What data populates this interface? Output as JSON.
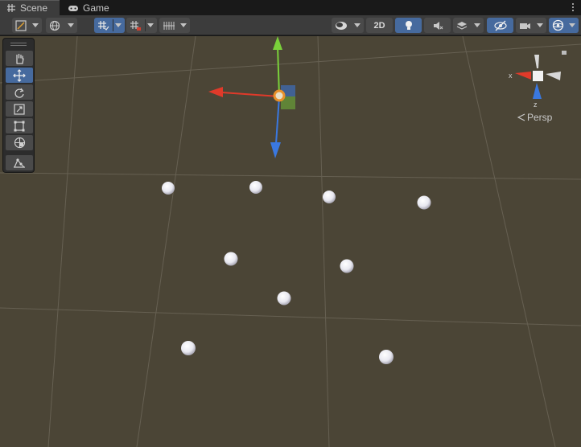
{
  "tabs": [
    {
      "label": "Scene",
      "icon": "grid-hash-icon",
      "active": true
    },
    {
      "label": "Game",
      "icon": "gamepad-icon",
      "active": false
    }
  ],
  "toolbar": {
    "buttons": [
      {
        "name": "draw-mode-dropdown",
        "icon": "shading-mode-icon"
      },
      {
        "name": "global-local-dropdown",
        "icon": "globe-icon"
      },
      {
        "name": "grid-snapping-dropdown",
        "icon": "grid-snap-icon",
        "active": true
      },
      {
        "name": "increment-snap-dropdown",
        "icon": "increment-snap-icon"
      },
      {
        "name": "grid-visibility-dropdown",
        "icon": "grid-lines-icon"
      },
      {
        "name": "render-mode-dropdown",
        "icon": "sphere-shading-icon"
      },
      {
        "name": "lighting-toggle",
        "icon": "lightbulb-icon",
        "active": true
      },
      {
        "name": "audio-toggle",
        "icon": "speaker-icon"
      },
      {
        "name": "effects-dropdown",
        "icon": "effects-layers-icon"
      },
      {
        "name": "hidden-objects-toggle",
        "icon": "eye-slash-icon",
        "active": true
      },
      {
        "name": "camera-dropdown",
        "icon": "camera-icon"
      },
      {
        "name": "gizmos-dropdown",
        "icon": "gizmo-sphere-icon",
        "active": true
      }
    ],
    "mode_2d_label": "2D"
  },
  "tools": [
    {
      "name": "hand-tool",
      "icon": "hand-icon",
      "active": false
    },
    {
      "name": "move-tool",
      "icon": "move-arrows-icon",
      "active": true
    },
    {
      "name": "rotate-tool",
      "icon": "rotate-icon",
      "active": false
    },
    {
      "name": "scale-tool",
      "icon": "scale-icon",
      "active": false
    },
    {
      "name": "rect-tool",
      "icon": "rect-icon",
      "active": false
    },
    {
      "name": "transform-tool",
      "icon": "transform-icon",
      "active": false
    },
    {
      "name": "custom-tool",
      "icon": "custom-tool-icon",
      "active": false
    }
  ],
  "gizmo": {
    "projection_label": "Persp",
    "x_label": "x",
    "z_label": "z"
  },
  "colors": {
    "x_axis": "#e03a2a",
    "y_axis": "#7ad03a",
    "z_axis": "#3a78e0",
    "viewport_bg": "#4b4536",
    "active_button": "#466a9e"
  },
  "scene_objects": [
    {
      "name": "sphere-1"
    },
    {
      "name": "sphere-2"
    },
    {
      "name": "sphere-3"
    },
    {
      "name": "sphere-4"
    },
    {
      "name": "sphere-5"
    },
    {
      "name": "sphere-6"
    },
    {
      "name": "sphere-7"
    },
    {
      "name": "sphere-8"
    },
    {
      "name": "sphere-9"
    }
  ]
}
